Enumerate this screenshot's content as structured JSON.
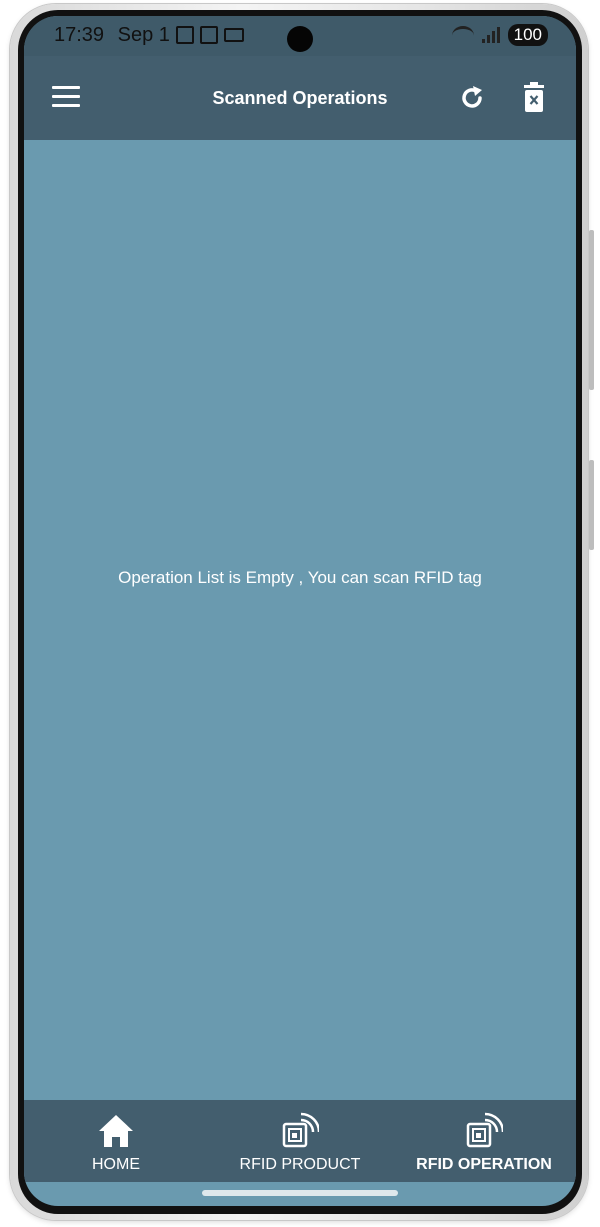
{
  "status_bar": {
    "time": "17:39",
    "date": "Sep 1",
    "battery": "100"
  },
  "app_bar": {
    "title": "Scanned Operations"
  },
  "main": {
    "empty_message": "Operation List is Empty , You can scan RFID tag"
  },
  "bottom_nav": {
    "items": [
      {
        "label": "HOME",
        "icon": "home-icon"
      },
      {
        "label": "RFID PRODUCT",
        "icon": "rfid-icon"
      },
      {
        "label": "RFID OPERATION",
        "icon": "rfid-icon",
        "active": true
      }
    ]
  },
  "colors": {
    "app_bar": "#435e6e",
    "background": "#6a9aaf",
    "text": "#ffffff"
  }
}
